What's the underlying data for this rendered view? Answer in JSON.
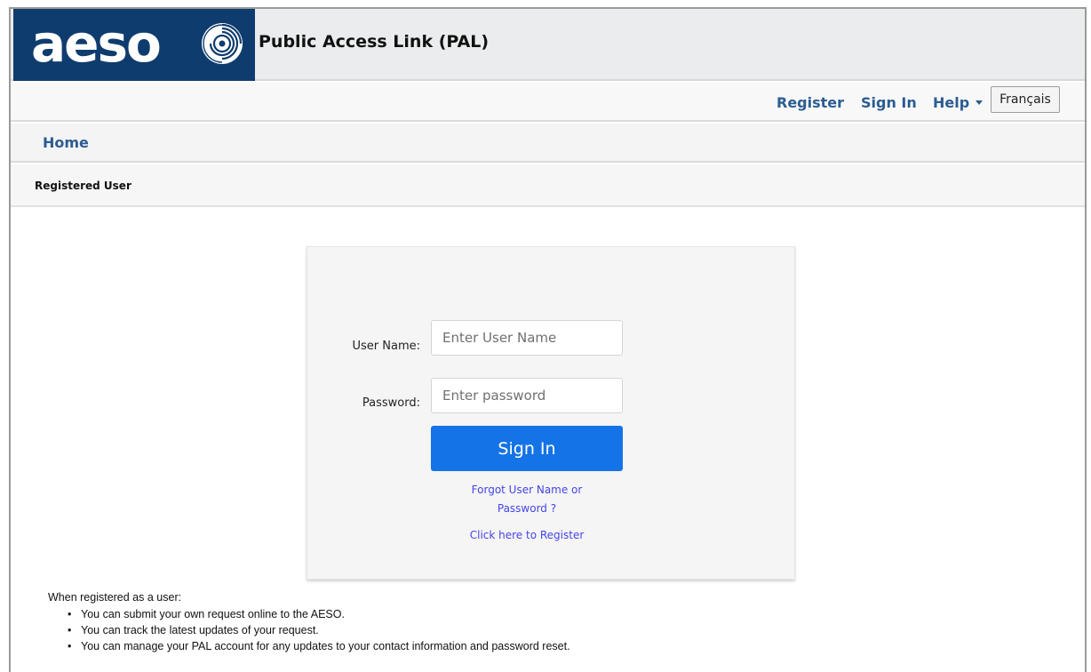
{
  "header": {
    "logo_text": "aeso",
    "app_title": "Public Access Link (PAL)"
  },
  "topnav": {
    "register": "Register",
    "sign_in": "Sign In",
    "help": "Help",
    "language": "Français"
  },
  "homebar": {
    "home": "Home"
  },
  "section": {
    "title": "Registered User"
  },
  "login": {
    "username_label": "User Name:",
    "username_placeholder": "Enter User Name",
    "password_label": "Password:",
    "password_placeholder": "Enter password",
    "sign_in_button": "Sign In",
    "forgot_line1": "Forgot User Name or",
    "forgot_line2": "Password ?",
    "register_link": "Click here to Register"
  },
  "info": {
    "intro": "When registered as a user:",
    "bullets": [
      "You can submit your own request online to the AESO.",
      "You can track the latest updates of your request.",
      "You can manage your PAL account for any updates to your contact information and password reset."
    ]
  },
  "colors": {
    "brand_navy": "#0f3c6e",
    "link_blue": "#2c5c91",
    "button_blue": "#1473e6"
  }
}
